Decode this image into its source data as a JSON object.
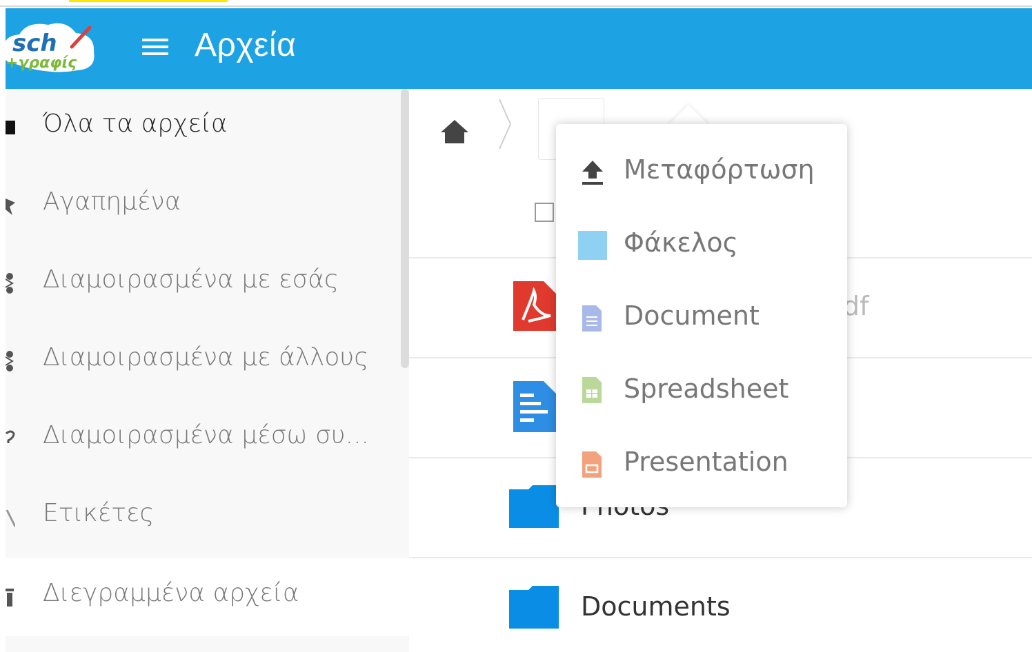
{
  "app": {
    "title": "Αρχεία",
    "logo_text": "sch ‑γραφίς"
  },
  "colors": {
    "header": "#1da2e3",
    "folder": "#0a8ee5",
    "pdf": "#e03a2f",
    "doc": "#2d8ee3"
  },
  "sidebar": {
    "items": [
      {
        "label": "Όλα τα αρχεία",
        "icon": "folder-icon",
        "active": true
      },
      {
        "label": "Αγαπημένα",
        "icon": "star-icon"
      },
      {
        "label": "Διαμοιρασμένα με εσάς",
        "icon": "share-icon"
      },
      {
        "label": "Διαμοιρασμένα με άλλους",
        "icon": "share-icon"
      },
      {
        "label": "Διαμοιρασμένα μέσω συ...",
        "icon": "link-icon"
      },
      {
        "label": "Ετικέτες",
        "icon": "tag-icon"
      },
      {
        "label": "Διεγραμμένα αρχεία",
        "icon": "trash-icon"
      }
    ]
  },
  "files": [
    {
      "name": "df",
      "type": "pdf"
    },
    {
      "name": "",
      "type": "document"
    },
    {
      "name": "Photos",
      "type": "folder"
    },
    {
      "name": "Documents",
      "type": "folder"
    }
  ],
  "new_menu": {
    "items": [
      {
        "label": "Μεταφόρτωση",
        "icon": "upload-icon"
      },
      {
        "label": "Φάκελος",
        "icon": "folder-icon"
      },
      {
        "label": "Document",
        "icon": "document-icon"
      },
      {
        "label": "Spreadsheet",
        "icon": "spreadsheet-icon"
      },
      {
        "label": "Presentation",
        "icon": "presentation-icon"
      }
    ]
  }
}
